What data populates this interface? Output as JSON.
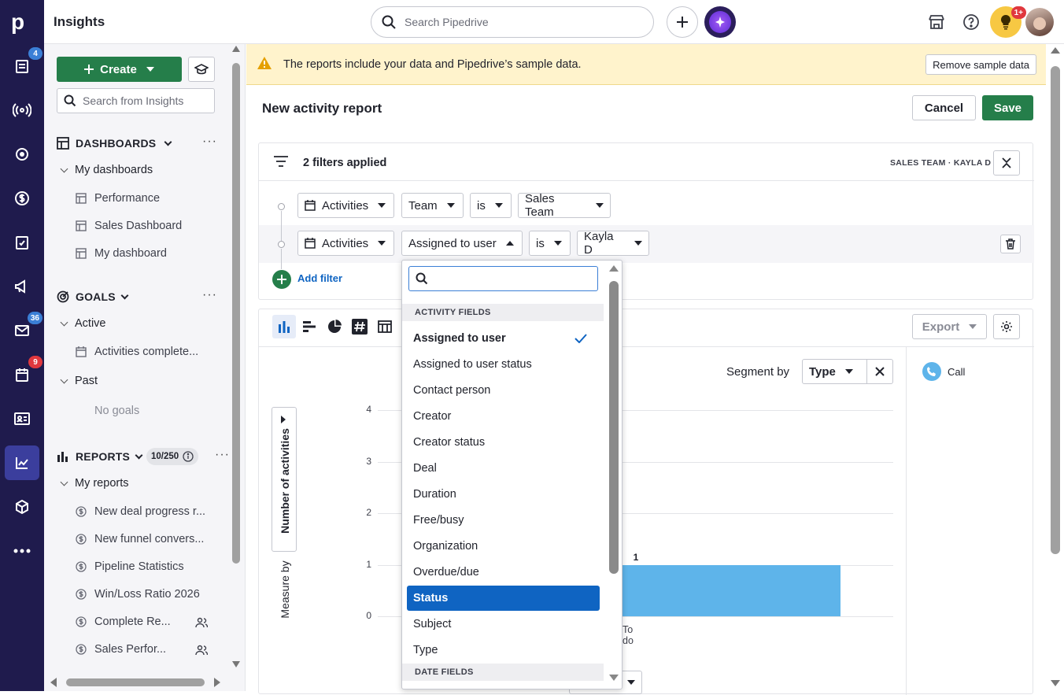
{
  "app": {
    "title": "Insights"
  },
  "rail": {
    "badges": {
      "activities": "4",
      "mail": "36",
      "calendar": "9"
    }
  },
  "topbar": {
    "search_placeholder": "Search Pipedrive",
    "notification_badge": "1+"
  },
  "sidebar": {
    "create_label": "Create",
    "search_placeholder": "Search from Insights",
    "dashboards": {
      "title": "DASHBOARDS",
      "group": "My dashboards",
      "items": [
        "Performance",
        "Sales Dashboard",
        "My dashboard"
      ]
    },
    "goals": {
      "title": "GOALS",
      "active_label": "Active",
      "active_items": [
        "Activities complete..."
      ],
      "past_label": "Past",
      "past_empty": "No goals"
    },
    "reports": {
      "title": "REPORTS",
      "count": "10/250",
      "group": "My reports",
      "items": [
        "New deal progress r...",
        "New funnel convers...",
        "Pipeline Statistics",
        "Win/Loss Ratio 2026",
        "Complete Re...",
        "Sales Perfor..."
      ]
    }
  },
  "banner": {
    "text": "The reports include your data and Pipedrive’s sample data.",
    "remove_label": "Remove sample data"
  },
  "report": {
    "title": "New activity report",
    "cancel_label": "Cancel",
    "save_label": "Save"
  },
  "filters": {
    "summary": "2 filters applied",
    "tags": "SALES TEAM · KAYLA D",
    "row1": {
      "entity": "Activities",
      "field": "Team",
      "op": "is",
      "value": "Sales Team"
    },
    "row2": {
      "entity": "Activities",
      "field": "Assigned to user",
      "op": "is",
      "value": "Kayla D"
    },
    "add_label": "Add filter"
  },
  "toolbar": {
    "export_label": "Export",
    "segment_label": "Segment by",
    "segment_value": "Type"
  },
  "legend": {
    "items": [
      "Call"
    ]
  },
  "chart_data": {
    "type": "bar",
    "categories": [
      "To do"
    ],
    "values": [
      1
    ],
    "data_labels": [
      "1"
    ],
    "ylabel": "Number of activities",
    "measure_label": "Measure by",
    "yticks": [
      "0",
      "1",
      "2",
      "3",
      "4"
    ],
    "ylim": [
      0,
      4
    ],
    "series": [
      {
        "name": "Call",
        "values": [
          1
        ]
      }
    ],
    "color": "#5eb4ea"
  },
  "dropdown": {
    "groups": [
      {
        "title": "ACTIVITY FIELDS",
        "items": [
          "Assigned to user",
          "Assigned to user status",
          "Contact person",
          "Creator",
          "Creator status",
          "Deal",
          "Duration",
          "Free/busy",
          "Organization",
          "Overdue/due",
          "Status",
          "Subject",
          "Type"
        ]
      },
      {
        "title": "DATE FIELDS",
        "items": []
      }
    ],
    "checked": "Assigned to user",
    "highlighted": "Status"
  }
}
